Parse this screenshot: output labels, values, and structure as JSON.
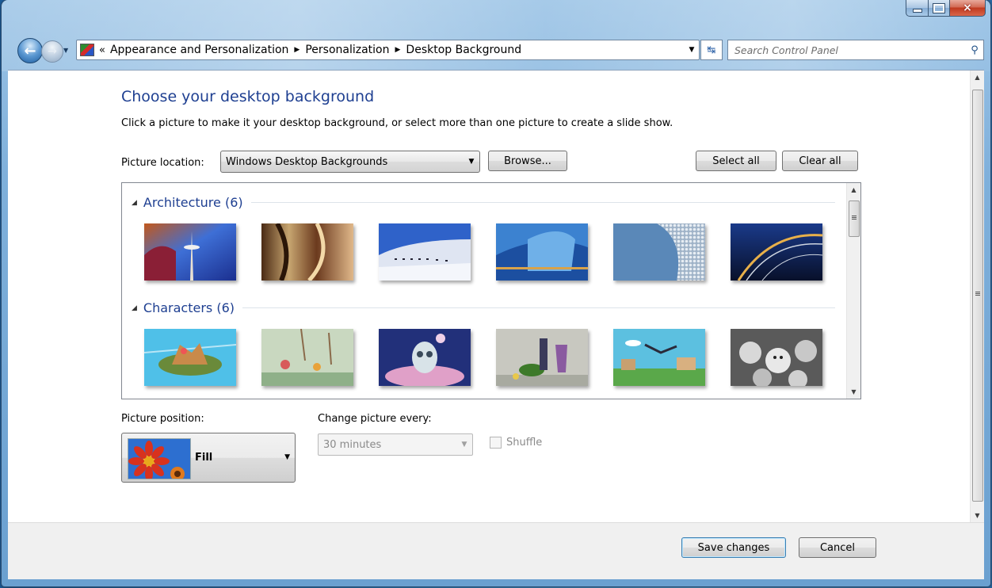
{
  "window": {
    "caption_minimize": "minimize",
    "caption_maximize": "maximize",
    "caption_close": "×"
  },
  "navigation": {
    "back_icon": "back-arrow-icon",
    "forward_icon": "forward-arrow-icon",
    "address_overflow": "«",
    "breadcrumb": [
      "Appearance and Personalization",
      "Personalization",
      "Desktop Background"
    ],
    "search_placeholder": "Search Control Panel"
  },
  "page": {
    "title": "Choose your desktop background",
    "description": "Click a picture to make it your desktop background, or select more than one picture to create a slide show.",
    "picture_location_label": "Picture location:",
    "picture_location_value": "Windows Desktop Backgrounds",
    "browse_label": "Browse...",
    "select_all_label": "Select all",
    "clear_all_label": "Clear all"
  },
  "gallery": {
    "groups": [
      {
        "title": "Architecture (6)",
        "count": 6
      },
      {
        "title": "Characters (6)",
        "count": 6
      }
    ]
  },
  "options": {
    "picture_position_label": "Picture position:",
    "picture_position_value": "Fill",
    "change_every_label": "Change picture every:",
    "change_every_value": "30 minutes",
    "shuffle_label": "Shuffle",
    "shuffle_checked": false
  },
  "footer": {
    "save_label": "Save changes",
    "cancel_label": "Cancel"
  }
}
